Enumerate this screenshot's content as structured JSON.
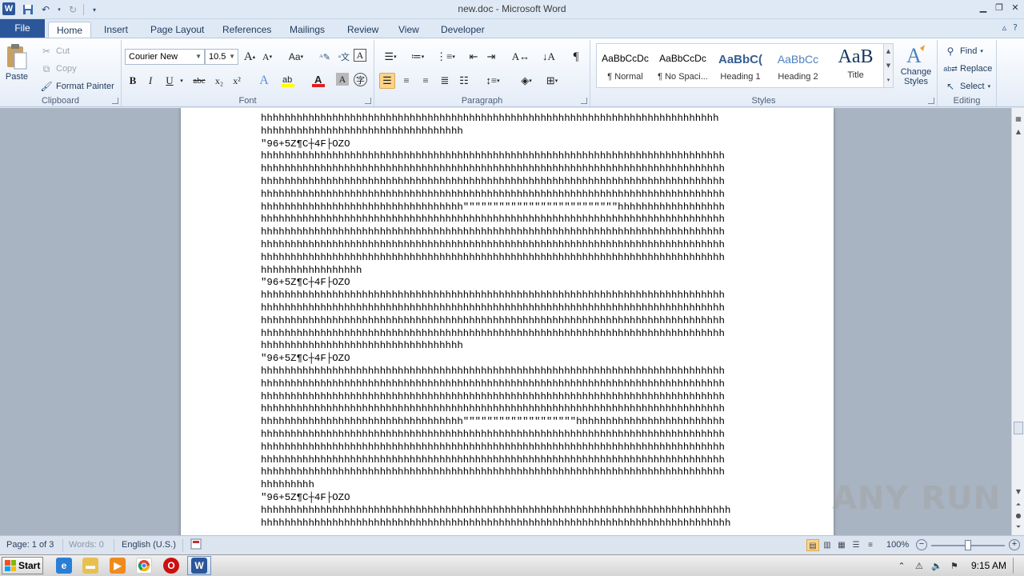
{
  "window": {
    "title": "new.doc - Microsoft Word",
    "app_icon_letter": "W",
    "controls": [
      "minimize-icon",
      "restore-icon",
      "close-icon"
    ]
  },
  "tabs": [
    "File",
    "Home",
    "Insert",
    "Page Layout",
    "References",
    "Mailings",
    "Review",
    "View",
    "Developer"
  ],
  "active_tab": "Home",
  "ribbon": {
    "clipboard": {
      "label": "Clipboard",
      "paste": "Paste",
      "cut": "Cut",
      "copy": "Copy",
      "format_painter": "Format Painter"
    },
    "font": {
      "label": "Font",
      "font_name": "Courier New",
      "font_size": "10.5",
      "grow": "A",
      "shrink": "A",
      "change_case": "Aa",
      "bold": "B",
      "italic": "I",
      "underline": "U",
      "strike": "abc",
      "subscript": "x₂",
      "superscript": "x²"
    },
    "paragraph": {
      "label": "Paragraph",
      "show_marks": "¶"
    },
    "styles": {
      "label": "Styles",
      "items": [
        {
          "sample": "AaBbCcDc",
          "name": "¶ Normal"
        },
        {
          "sample": "AaBbCcDc",
          "name": "¶ No Spaci..."
        },
        {
          "sample": "AaBbC(",
          "name": "Heading 1"
        },
        {
          "sample": "AaBbCc",
          "name": "Heading 2"
        },
        {
          "sample": "AaB",
          "name": "Title"
        }
      ],
      "change_styles": "Change Styles"
    },
    "editing": {
      "label": "Editing",
      "find": "Find",
      "replace": "Replace",
      "select": "Select"
    }
  },
  "document": {
    "lines": [
      "hhhhhhhhhhhhhhhhhhhhhhhhhhhhhhhhhhhhhhhhhhhhhhhhhhhhhhhhhhhhhhhhhhhhhhhhhhhhh",
      "hhhhhhhhhhhhhhhhhhhhhhhhhhhhhhhhhh",
      "\"96+5Z¶C┼4F├OZO",
      "hhhhhhhhhhhhhhhhhhhhhhhhhhhhhhhhhhhhhhhhhhhhhhhhhhhhhhhhhhhhhhhhhhhhhhhhhhhhhh",
      "hhhhhhhhhhhhhhhhhhhhhhhhhhhhhhhhhhhhhhhhhhhhhhhhhhhhhhhhhhhhhhhhhhhhhhhhhhhhhh",
      "hhhhhhhhhhhhhhhhhhhhhhhhhhhhhhhhhhhhhhhhhhhhhhhhhhhhhhhhhhhhhhhhhhhhhhhhhhhhhh",
      "hhhhhhhhhhhhhhhhhhhhhhhhhhhhhhhhhhhhhhhhhhhhhhhhhhhhhhhhhhhhhhhhhhhhhhhhhhhhhh",
      "hhhhhhhhhhhhhhhhhhhhhhhhhhhhhhhhhh\"\"\"\"\"\"\"\"\"\"\"\"\"\"\"\"\"\"\"\"\"\"\"\"\"\"hhhhhhhhhhhhhhhhhh",
      "hhhhhhhhhhhhhhhhhhhhhhhhhhhhhhhhhhhhhhhhhhhhhhhhhhhhhhhhhhhhhhhhhhhhhhhhhhhhhh",
      "hhhhhhhhhhhhhhhhhhhhhhhhhhhhhhhhhhhhhhhhhhhhhhhhhhhhhhhhhhhhhhhhhhhhhhhhhhhhhh",
      "hhhhhhhhhhhhhhhhhhhhhhhhhhhhhhhhhhhhhhhhhhhhhhhhhhhhhhhhhhhhhhhhhhhhhhhhhhhhhh",
      "hhhhhhhhhhhhhhhhhhhhhhhhhhhhhhhhhhhhhhhhhhhhhhhhhhhhhhhhhhhhhhhhhhhhhhhhhhhhhh",
      "hhhhhhhhhhhhhhhhh",
      "\"96+5Z¶C┼4F├OZO",
      "hhhhhhhhhhhhhhhhhhhhhhhhhhhhhhhhhhhhhhhhhhhhhhhhhhhhhhhhhhhhhhhhhhhhhhhhhhhhhh",
      "hhhhhhhhhhhhhhhhhhhhhhhhhhhhhhhhhhhhhhhhhhhhhhhhhhhhhhhhhhhhhhhhhhhhhhhhhhhhhh",
      "hhhhhhhhhhhhhhhhhhhhhhhhhhhhhhhhhhhhhhhhhhhhhhhhhhhhhhhhhhhhhhhhhhhhhhhhhhhhhh",
      "hhhhhhhhhhhhhhhhhhhhhhhhhhhhhhhhhhhhhhhhhhhhhhhhhhhhhhhhhhhhhhhhhhhhhhhhhhhhhh",
      "hhhhhhhhhhhhhhhhhhhhhhhhhhhhhhhhhh",
      "\"96+5Z¶C┼4F├OZO",
      "hhhhhhhhhhhhhhhhhhhhhhhhhhhhhhhhhhhhhhhhhhhhhhhhhhhhhhhhhhhhhhhhhhhhhhhhhhhhhh",
      "hhhhhhhhhhhhhhhhhhhhhhhhhhhhhhhhhhhhhhhhhhhhhhhhhhhhhhhhhhhhhhhhhhhhhhhhhhhhhh",
      "hhhhhhhhhhhhhhhhhhhhhhhhhhhhhhhhhhhhhhhhhhhhhhhhhhhhhhhhhhhhhhhhhhhhhhhhhhhhhh",
      "hhhhhhhhhhhhhhhhhhhhhhhhhhhhhhhhhhhhhhhhhhhhhhhhhhhhhhhhhhhhhhhhhhhhhhhhhhhhhh",
      "hhhhhhhhhhhhhhhhhhhhhhhhhhhhhhhhhh\"\"\"\"\"\"\"\"\"\"\"\"\"\"\"\"\"\"\"hhhhhhhhhhhhhhhhhhhhhhhhh",
      "hhhhhhhhhhhhhhhhhhhhhhhhhhhhhhhhhhhhhhhhhhhhhhhhhhhhhhhhhhhhhhhhhhhhhhhhhhhhhh",
      "hhhhhhhhhhhhhhhhhhhhhhhhhhhhhhhhhhhhhhhhhhhhhhhhhhhhhhhhhhhhhhhhhhhhhhhhhhhhhh",
      "hhhhhhhhhhhhhhhhhhhhhhhhhhhhhhhhhhhhhhhhhhhhhhhhhhhhhhhhhhhhhhhhhhhhhhhhhhhhhh",
      "hhhhhhhhhhhhhhhhhhhhhhhhhhhhhhhhhhhhhhhhhhhhhhhhhhhhhhhhhhhhhhhhhhhhhhhhhhhhhh",
      "hhhhhhhhh",
      "\"96+5Z¶C┼4F├OZO",
      "hhhhhhhhhhhhhhhhhhhhhhhhhhhhhhhhhhhhhhhhhhhhhhhhhhhhhhhhhhhhhhhhhhhhhhhhhhhhhhh",
      "hhhhhhhhhhhhhhhhhhhhhhhhhhhhhhhhhhhhhhhhhhhhhhhhhhhhhhhhhhhhhhhhhhhhhhhhhhhhhhh"
    ]
  },
  "statusbar": {
    "page": "Page: 1 of 3",
    "words": "Words: 0",
    "language": "English (U.S.)",
    "zoom": "100%",
    "zoom_level_percent": 100
  },
  "taskbar": {
    "start": "Start",
    "time": "9:15 AM"
  },
  "watermark": "ANY RUN",
  "colors": {
    "file_tab": "#2b579a",
    "ribbon_bg": "#e4ecf7",
    "doc_bg": "#a9b4c2",
    "selected_button": "#fcd48a"
  }
}
